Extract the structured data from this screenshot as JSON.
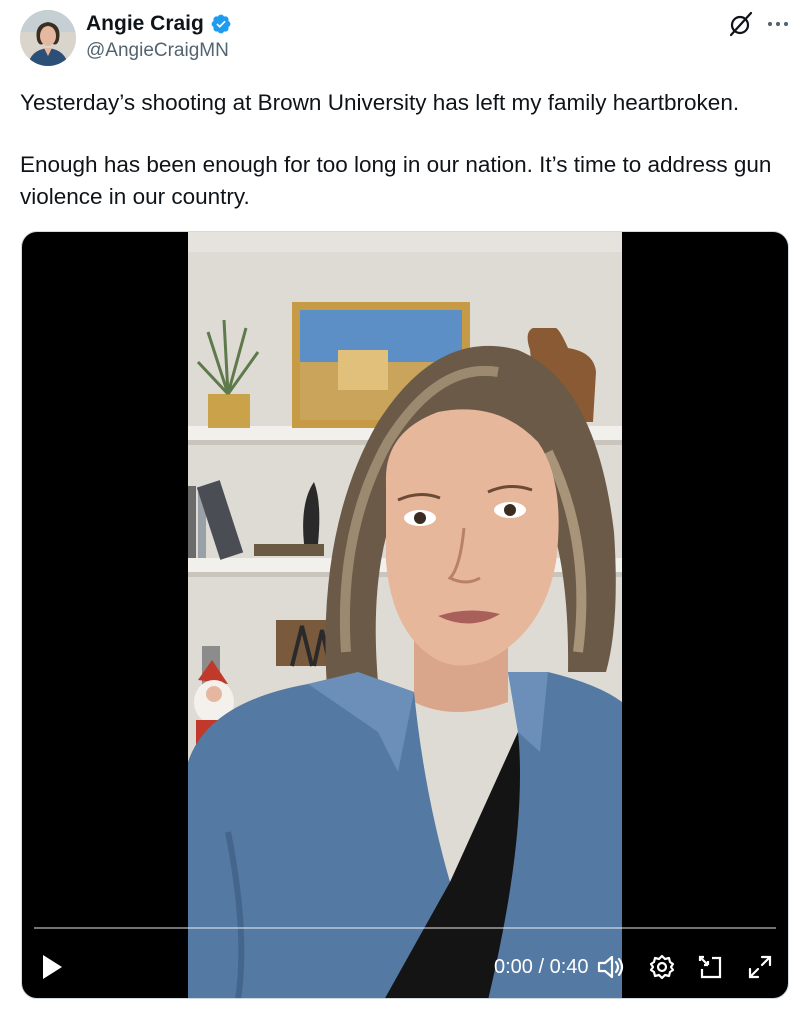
{
  "author": {
    "display_name": "Angie Craig",
    "handle": "@AngieCraigMN",
    "verified": true,
    "verified_color": "#1d9bf0"
  },
  "header_icons": [
    "grok-icon",
    "more-options-icon"
  ],
  "tweet": {
    "paragraphs": [
      "Yesterday’s shooting at Brown University has left my family heartbroken.",
      "Enough has been enough for too long in our nation. It’s time to address gun violence in our country."
    ]
  },
  "video": {
    "current_time": "0:00",
    "duration": "0:40",
    "time_display": "0:00 / 0:40",
    "progress": 0,
    "controls": [
      "play-icon",
      "volume-icon",
      "settings-icon",
      "picture-in-picture-icon",
      "fullscreen-icon"
    ],
    "accent_color": "#1d9bf0"
  }
}
